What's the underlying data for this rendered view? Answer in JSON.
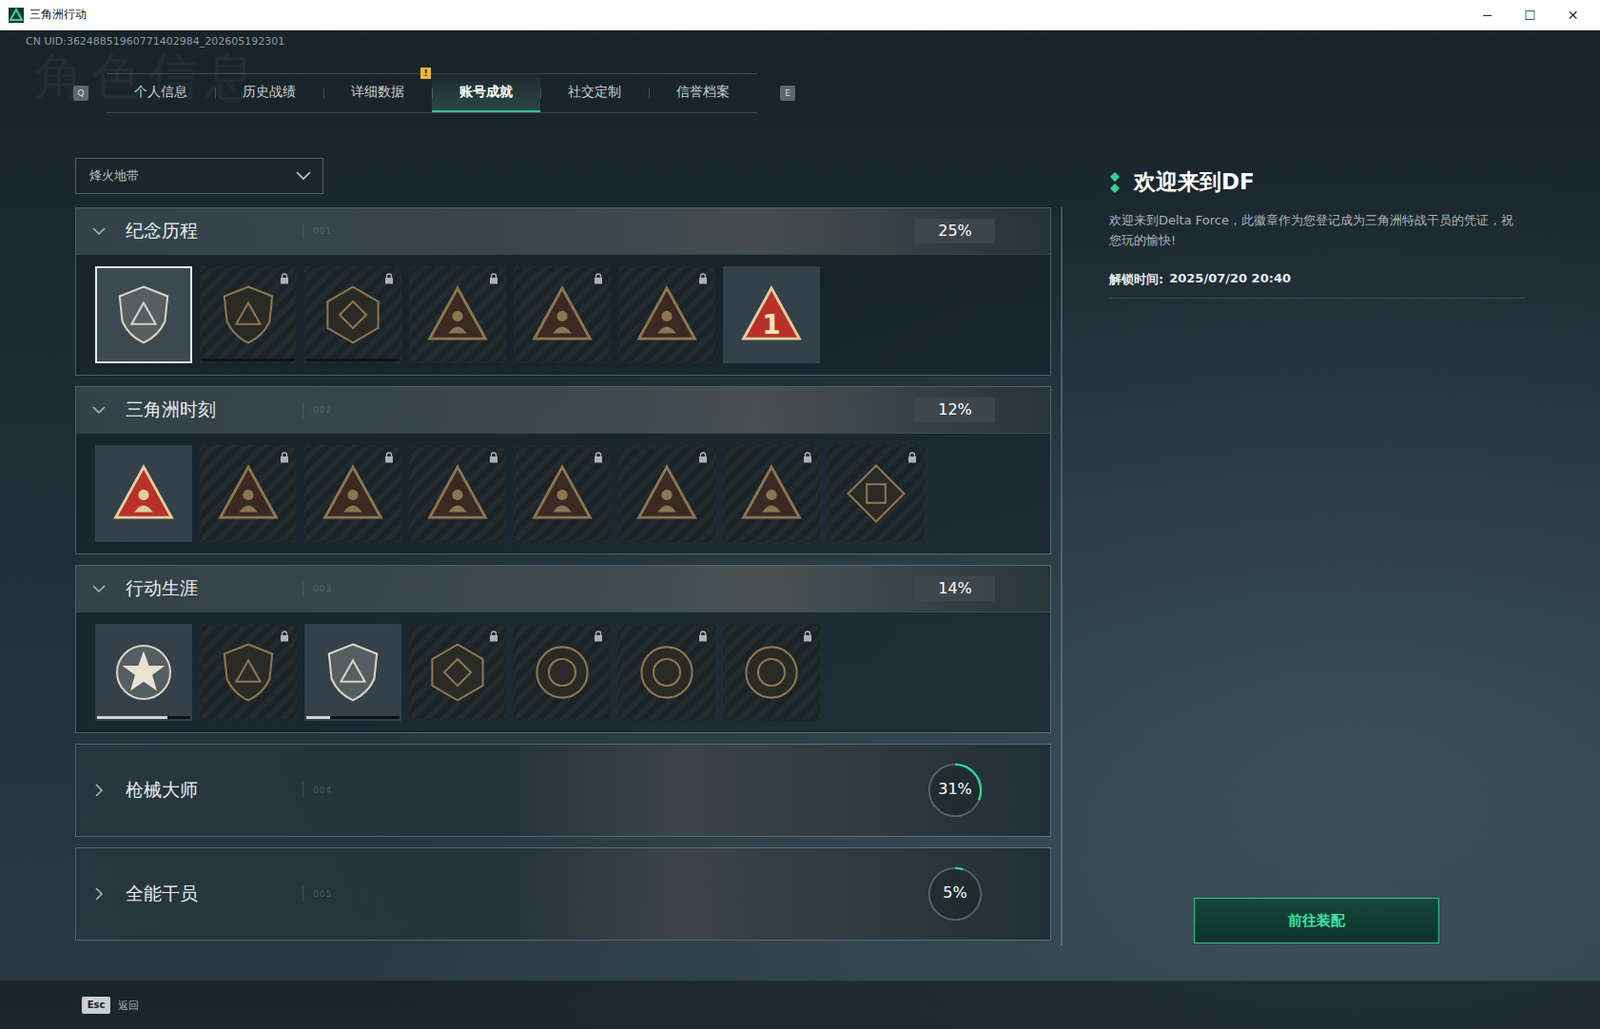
{
  "window": {
    "title": "三角洲行动",
    "controls": [
      "─",
      "☐",
      "✕"
    ]
  },
  "uid": "CN UID:36248851960771402984_202605192301",
  "watermark": "角色信息",
  "tabs": {
    "prev_key": "Q",
    "next_key": "E",
    "alert_mark": "!",
    "items": [
      {
        "label": "个人信息",
        "selected": false,
        "alert": false
      },
      {
        "label": "历史战绩",
        "selected": false,
        "alert": false
      },
      {
        "label": "详细数据",
        "selected": false,
        "alert": false
      },
      {
        "label": "账号成就",
        "selected": true,
        "alert": true
      },
      {
        "label": "社交定制",
        "selected": false,
        "alert": false
      },
      {
        "label": "信誉档案",
        "selected": false,
        "alert": false
      }
    ]
  },
  "mode_select": {
    "value": "烽火地带",
    "expanded": false
  },
  "sections": [
    {
      "title": "纪念历程",
      "code": "001",
      "percent": "25%",
      "expanded": true,
      "badges": [
        {
          "kind": "shield",
          "unlocked": true,
          "selected": true
        },
        {
          "kind": "shield",
          "unlocked": false,
          "selected": false,
          "level": 0
        },
        {
          "kind": "hexagon",
          "unlocked": false,
          "selected": false,
          "level": 0
        },
        {
          "kind": "triangle",
          "unlocked": false,
          "selected": false
        },
        {
          "kind": "triangle",
          "unlocked": false,
          "selected": false
        },
        {
          "kind": "triangle",
          "unlocked": false,
          "selected": false
        },
        {
          "kind": "triangle",
          "unlocked": true,
          "selected": false,
          "mark": "1"
        }
      ]
    },
    {
      "title": "三角洲时刻",
      "code": "002",
      "percent": "12%",
      "expanded": true,
      "badges": [
        {
          "kind": "triangle",
          "unlocked": true,
          "selected": false
        },
        {
          "kind": "triangle",
          "unlocked": false,
          "selected": false
        },
        {
          "kind": "triangle",
          "unlocked": false,
          "selected": false
        },
        {
          "kind": "triangle",
          "unlocked": false,
          "selected": false
        },
        {
          "kind": "triangle",
          "unlocked": false,
          "selected": false
        },
        {
          "kind": "triangle",
          "unlocked": false,
          "selected": false
        },
        {
          "kind": "triangle",
          "unlocked": false,
          "selected": false
        },
        {
          "kind": "diamond",
          "unlocked": false,
          "selected": false
        }
      ]
    },
    {
      "title": "行动生涯",
      "code": "003",
      "percent": "14%",
      "expanded": true,
      "badges": [
        {
          "kind": "star",
          "unlocked": true,
          "selected": false,
          "level": 0.75
        },
        {
          "kind": "shield",
          "unlocked": false,
          "selected": false
        },
        {
          "kind": "shield",
          "unlocked": true,
          "selected": false,
          "level": 0.25
        },
        {
          "kind": "hexagon",
          "unlocked": false,
          "selected": false
        },
        {
          "kind": "circle",
          "unlocked": false,
          "selected": false
        },
        {
          "kind": "circle",
          "unlocked": false,
          "selected": false
        },
        {
          "kind": "circle",
          "unlocked": false,
          "selected": false
        }
      ]
    },
    {
      "title": "枪械大师",
      "code": "004",
      "percent": "31%",
      "expanded": false,
      "level": 0.31,
      "badges": []
    },
    {
      "title": "全能干员",
      "code": "005",
      "percent": "5%",
      "expanded": false,
      "level": 0.05,
      "badges": []
    }
  ],
  "detail": {
    "title": "欢迎来到DF",
    "description": "欢迎来到Delta Force，此徽章作为您登记成为三角洲特战干员的凭证，祝您玩的愉快!",
    "unlock_label": "解锁时间:",
    "unlock_time": "2025/07/20 20:40",
    "button": "前往装配"
  },
  "footer": {
    "key": "Esc",
    "label": "返回"
  }
}
